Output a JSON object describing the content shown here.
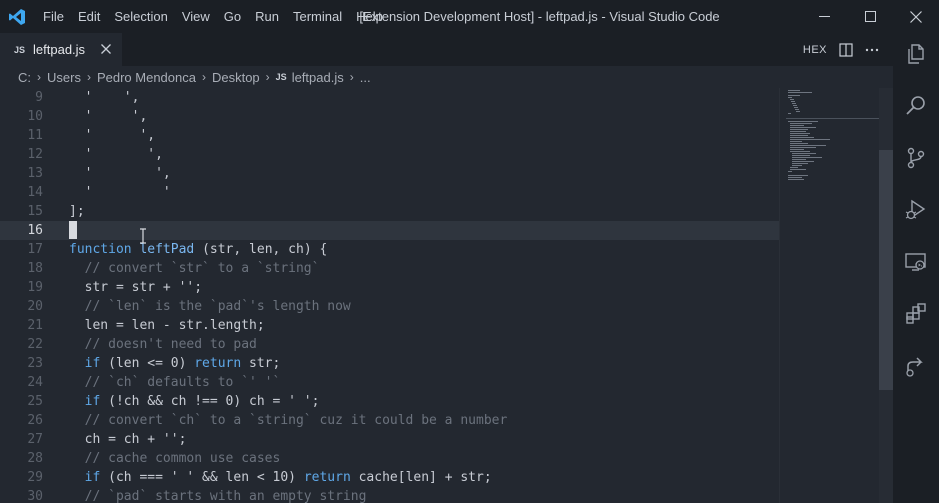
{
  "titlebar": {
    "menu": [
      "File",
      "Edit",
      "Selection",
      "View",
      "Go",
      "Run",
      "Terminal",
      "Help"
    ],
    "window_title": "[Extension Development Host] - leftpad.js - Visual Studio Code"
  },
  "tab": {
    "icon_label": "JS",
    "label": "leftpad.js"
  },
  "editor_actions": {
    "hex_label": "HEX"
  },
  "breadcrumb": {
    "items": [
      "C:",
      "Users",
      "Pedro Mendonca",
      "Desktop"
    ],
    "file_icon_label": "JS",
    "file": "leftpad.js",
    "ellipsis": "..."
  },
  "code": {
    "line_numbers": [
      "9",
      "10",
      "11",
      "12",
      "13",
      "14",
      "15",
      "16",
      "17",
      "18",
      "19",
      "20",
      "21",
      "22",
      "23",
      "24",
      "25",
      "26",
      "27",
      "28",
      "29",
      "30"
    ],
    "current_line": "16"
  },
  "icons": {
    "activity": [
      "explorer-icon",
      "search-icon",
      "source-control-icon",
      "run-debug-icon",
      "remote-explorer-icon",
      "extensions-icon",
      "live-share-icon"
    ]
  }
}
